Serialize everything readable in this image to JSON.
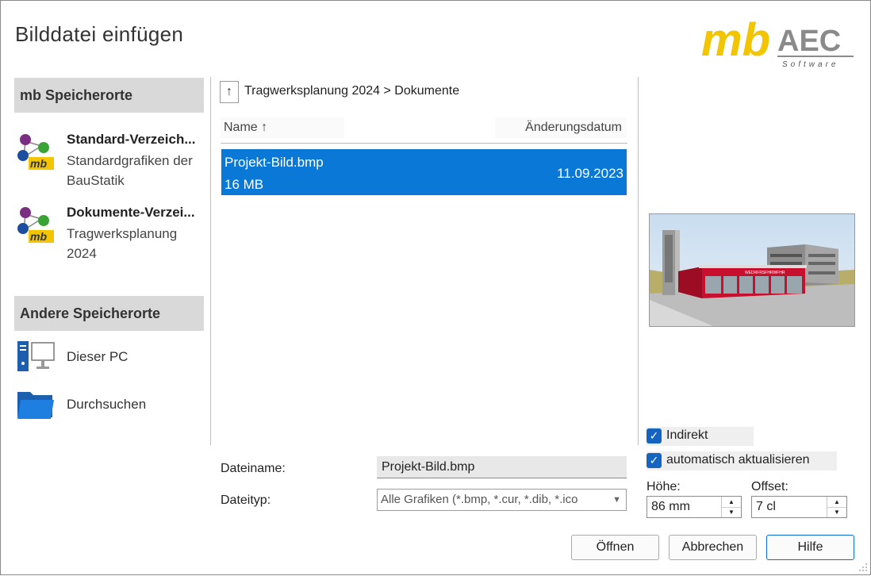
{
  "dialog": {
    "title": "Bilddatei einfügen"
  },
  "logo": {
    "brand_mb": "mb",
    "brand_aec": "AEC",
    "tagline": "Software"
  },
  "left_panel": {
    "mb_header": "mb Speicherorte",
    "mb_locations": [
      {
        "title": "Standard-Verzeich...",
        "subtitle": "Standardgrafiken der BauStatik",
        "icon": "mb-logo-icon"
      },
      {
        "title": "Dokumente-Verzei...",
        "subtitle": "Tragwerksplanung 2024",
        "icon": "mb-logo-icon"
      }
    ],
    "other_header": "Andere Speicherorte",
    "other_locations": [
      {
        "label": "Dieser PC",
        "icon": "computer-icon"
      },
      {
        "label": "Durchsuchen",
        "icon": "folder-icon"
      }
    ]
  },
  "file_browser": {
    "up_label": "↑",
    "breadcrumb": "Tragwerksplanung 2024 > Dokumente",
    "columns": {
      "name": "Name ↑",
      "date": "Änderungsdatum"
    },
    "files": [
      {
        "name": "Projekt-Bild.bmp",
        "size": "16 MB",
        "date": "11.09.2023",
        "selected": true
      }
    ]
  },
  "form": {
    "filename_label": "Dateiname:",
    "filename_value": "Projekt-Bild.bmp",
    "filetype_label": "Dateityp:",
    "filetype_value": "Alle Grafiken (*.bmp, *.cur, *.dib, *.ico"
  },
  "options": {
    "indirekt_label": "Indirekt",
    "indirekt_checked": true,
    "auto_update_label": "automatisch aktualisieren",
    "auto_update_checked": true,
    "height_label": "Höhe:",
    "height_value": "86 mm",
    "offset_label": "Offset:",
    "offset_value": "7 cl"
  },
  "buttons": {
    "open": "Öffnen",
    "cancel": "Abbrechen",
    "help": "Hilfe"
  },
  "preview": {
    "sign_text": "WEDRFRSFHRWFHR"
  },
  "colors": {
    "selection": "#0a78d7",
    "header_gray": "#d9d9d9",
    "logo_yellow": "#f3c400",
    "logo_gray": "#8a8a8a",
    "checkbox": "#1565c0"
  }
}
